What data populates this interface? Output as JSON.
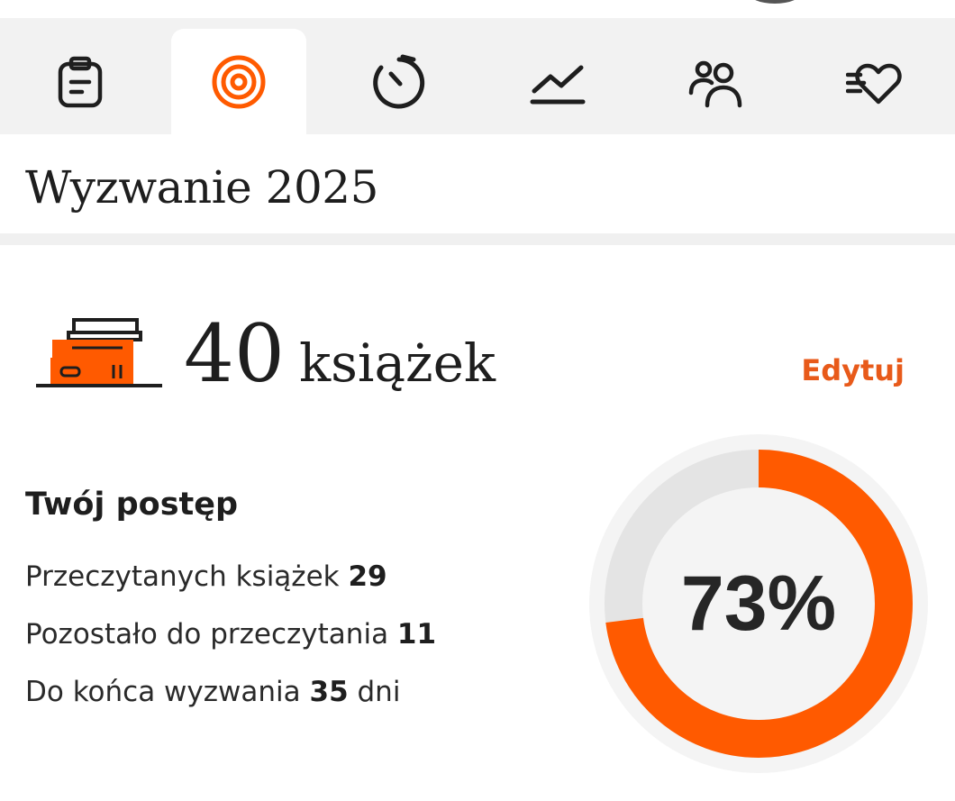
{
  "colors": {
    "accent": "#ff5a00",
    "accent_text": "#e85a1a",
    "track": "#e4e4e4",
    "text": "#1e1e1e"
  },
  "tabs": [
    {
      "icon": "clipboard-icon",
      "active": false
    },
    {
      "icon": "target-icon",
      "active": true
    },
    {
      "icon": "timer-icon",
      "active": false
    },
    {
      "icon": "trend-chart-icon",
      "active": false
    },
    {
      "icon": "people-icon",
      "active": false
    },
    {
      "icon": "heart-speed-icon",
      "active": false
    }
  ],
  "page": {
    "title": "Wyzwanie 2025"
  },
  "goal": {
    "count": "40",
    "unit": "książek",
    "edit_label": "Edytuj",
    "icon": "books-stack-icon"
  },
  "progress": {
    "heading": "Twój postęp",
    "read_label": "Przeczytanych książek",
    "read_value": "29",
    "remaining_label": "Pozostało do przeczytania",
    "remaining_value": "11",
    "days_label": "Do końca wyzwania",
    "days_value": "35",
    "days_unit": "dni",
    "percent_text": "73%",
    "fraction": 0.73
  }
}
